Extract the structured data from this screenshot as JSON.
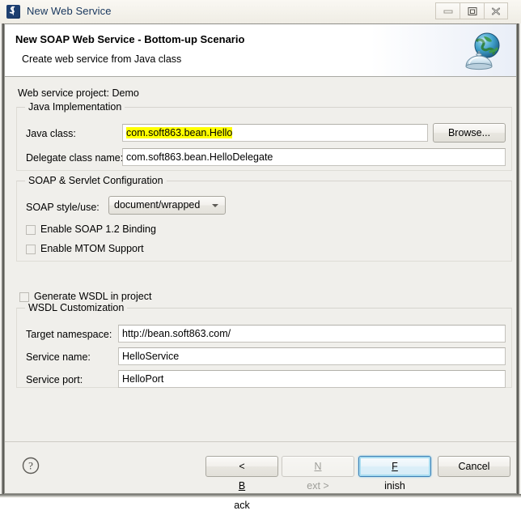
{
  "window": {
    "title": "New Web Service",
    "app_icon": "web-service-icon",
    "controls": [
      {
        "name": "minimize-button",
        "glyph": "minimize-icon"
      },
      {
        "name": "restore-button",
        "glyph": "restore-icon"
      },
      {
        "name": "close-button",
        "glyph": "close-icon"
      }
    ]
  },
  "header": {
    "title": "New SOAP Web Service - Bottom-up Scenario",
    "subtitle": "Create web service from Java class",
    "icon": "globe-service-icon"
  },
  "body": {
    "project_line": "Web service project: Demo",
    "java_group": {
      "label": "Java Implementation",
      "java_class_label": "Java class:",
      "java_class_value": "com.soft863.bean.Hello",
      "java_class_highlighted": true,
      "browse_label": "Browse...",
      "delegate_label": "Delegate class name:",
      "delegate_value": "com.soft863.bean.HelloDelegate"
    },
    "soap_group": {
      "label": "SOAP & Servlet Configuration",
      "style_label": "SOAP style/use:",
      "style_value": "document/wrapped",
      "style_options": [
        "document/wrapped"
      ],
      "checkboxes": [
        {
          "label": "Enable SOAP 1.2 Binding",
          "checked": false
        },
        {
          "label": "Enable MTOM Support",
          "checked": false
        }
      ]
    },
    "generate_wsdl": {
      "label": "Generate WSDL in project",
      "checked": false
    },
    "wsdl_group": {
      "label": "WSDL Customization",
      "rows": [
        {
          "label": "Target namespace:",
          "value": "http://bean.soft863.com/"
        },
        {
          "label": "Service name:",
          "value": "HelloService"
        },
        {
          "label": "Service port:",
          "value": "HelloPort"
        }
      ]
    }
  },
  "footer": {
    "help_icon": "help-question-icon",
    "buttons": [
      {
        "name": "back-button",
        "prefix": "< ",
        "mnemonic": "B",
        "suffix": "ack",
        "state": "enabled"
      },
      {
        "name": "next-button",
        "prefix": "",
        "mnemonic": "N",
        "suffix": "ext >",
        "state": "disabled"
      },
      {
        "name": "finish-button",
        "prefix": "",
        "mnemonic": "F",
        "suffix": "inish",
        "state": "default"
      },
      {
        "name": "cancel-button",
        "prefix": "",
        "mnemonic": "",
        "suffix": "Cancel",
        "state": "enabled"
      }
    ]
  },
  "colors": {
    "highlight": "#ffff00",
    "default_button_border": "#3d7fb5",
    "title_text": "#17365d",
    "dialog_bg": "#f0efeb"
  }
}
